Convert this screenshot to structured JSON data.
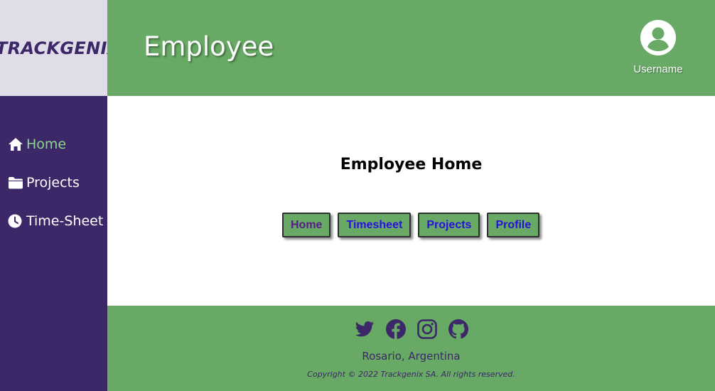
{
  "brand": {
    "logo_text": "TRACKGENIX"
  },
  "header": {
    "title": "Employee",
    "username": "Username",
    "user_icon": "user-circle-icon"
  },
  "sidebar": {
    "items": [
      {
        "label": "Home",
        "icon": "home-icon",
        "active": true
      },
      {
        "label": "Projects",
        "icon": "folder-icon",
        "active": false
      },
      {
        "label": "Time-Sheet",
        "icon": "clock-icon",
        "active": false
      }
    ]
  },
  "main": {
    "title": "Employee Home",
    "buttons": [
      {
        "label": "Home"
      },
      {
        "label": "Timesheet"
      },
      {
        "label": "Projects"
      },
      {
        "label": "Profile"
      }
    ]
  },
  "footer": {
    "social": [
      "twitter-icon",
      "facebook-icon",
      "instagram-icon",
      "github-icon"
    ],
    "location": "Rosario, Argentina",
    "copyright": "Copyright © 2022 Trackgenix SA. All rights reserved."
  },
  "colors": {
    "brand_purple": "#3c2768",
    "header_green": "#67a965",
    "logo_bg": "#dfdde8",
    "active_nav": "#8fd48c",
    "button_text": "#2a10e0"
  }
}
